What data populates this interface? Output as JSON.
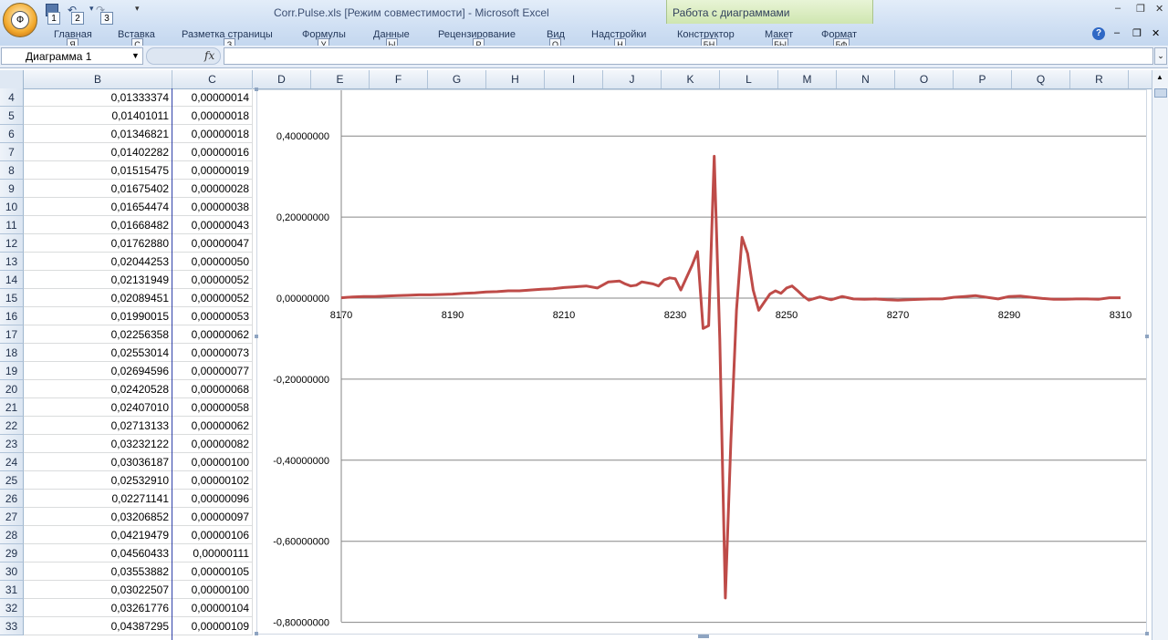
{
  "window": {
    "title": "Corr.Pulse.xls  [Режим совместимости] - Microsoft Excel",
    "context_group": "Работа с диаграммами",
    "office_button_keytip": "Ф",
    "qat_keytips": [
      "1",
      "2",
      "3"
    ],
    "controls": [
      "–",
      "❐",
      "✕"
    ],
    "ribbon_controls": [
      "–",
      "❐",
      "✕"
    ]
  },
  "ribbon": {
    "tabs": [
      {
        "label": "Главная",
        "keytip": "Я"
      },
      {
        "label": "Вставка",
        "keytip": "С"
      },
      {
        "label": "Разметка страницы",
        "keytip": "З"
      },
      {
        "label": "Формулы",
        "keytip": "У"
      },
      {
        "label": "Данные",
        "keytip": "Ы"
      },
      {
        "label": "Рецензирование",
        "keytip": "Р"
      },
      {
        "label": "Вид",
        "keytip": "О"
      },
      {
        "label": "Надстройки",
        "keytip": "Н"
      },
      {
        "label": "Конструктор",
        "keytip": "БН"
      },
      {
        "label": "Макет",
        "keytip": "БЫ"
      },
      {
        "label": "Формат",
        "keytip": "БФ"
      }
    ],
    "help": "?"
  },
  "formula_bar": {
    "name_box": "Диаграмма 1",
    "fx": "fx",
    "formula": ""
  },
  "sheet": {
    "columns": [
      "B",
      "C",
      "D",
      "E",
      "F",
      "G",
      "H",
      "I",
      "J",
      "K",
      "L",
      "M",
      "N",
      "O",
      "P",
      "Q",
      "R"
    ],
    "rows": [
      {
        "row": "4",
        "b": "0,01333374",
        "c": "0,00000014"
      },
      {
        "row": "5",
        "b": "0,01401011",
        "c": "0,00000018"
      },
      {
        "row": "6",
        "b": "0,01346821",
        "c": "0,00000018"
      },
      {
        "row": "7",
        "b": "0,01402282",
        "c": "0,00000016"
      },
      {
        "row": "8",
        "b": "0,01515475",
        "c": "0,00000019"
      },
      {
        "row": "9",
        "b": "0,01675402",
        "c": "0,00000028"
      },
      {
        "row": "10",
        "b": "0,01654474",
        "c": "0,00000038"
      },
      {
        "row": "11",
        "b": "0,01668482",
        "c": "0,00000043"
      },
      {
        "row": "12",
        "b": "0,01762880",
        "c": "0,00000047"
      },
      {
        "row": "13",
        "b": "0,02044253",
        "c": "0,00000050"
      },
      {
        "row": "14",
        "b": "0,02131949",
        "c": "0,00000052"
      },
      {
        "row": "15",
        "b": "0,02089451",
        "c": "0,00000052"
      },
      {
        "row": "16",
        "b": "0,01990015",
        "c": "0,00000053"
      },
      {
        "row": "17",
        "b": "0,02256358",
        "c": "0,00000062"
      },
      {
        "row": "18",
        "b": "0,02553014",
        "c": "0,00000073"
      },
      {
        "row": "19",
        "b": "0,02694596",
        "c": "0,00000077"
      },
      {
        "row": "20",
        "b": "0,02420528",
        "c": "0,00000068"
      },
      {
        "row": "21",
        "b": "0,02407010",
        "c": "0,00000058"
      },
      {
        "row": "22",
        "b": "0,02713133",
        "c": "0,00000062"
      },
      {
        "row": "23",
        "b": "0,03232122",
        "c": "0,00000082"
      },
      {
        "row": "24",
        "b": "0,03036187",
        "c": "0,00000100"
      },
      {
        "row": "25",
        "b": "0,02532910",
        "c": "0,00000102"
      },
      {
        "row": "26",
        "b": "0,02271141",
        "c": "0,00000096"
      },
      {
        "row": "27",
        "b": "0,03206852",
        "c": "0,00000097"
      },
      {
        "row": "28",
        "b": "0,04219479",
        "c": "0,00000106"
      },
      {
        "row": "29",
        "b": "0,04560433",
        "c": "0,00000111"
      },
      {
        "row": "30",
        "b": "0,03553882",
        "c": "0,00000105"
      },
      {
        "row": "31",
        "b": "0,03022507",
        "c": "0,00000100"
      },
      {
        "row": "32",
        "b": "0,03261776",
        "c": "0,00000104"
      },
      {
        "row": "33",
        "b": "0,04387295",
        "c": "0,00000109"
      }
    ]
  },
  "chart_data": {
    "type": "line",
    "title": "",
    "xlabel": "",
    "ylabel": "",
    "xlim": [
      8170,
      8310
    ],
    "ylim": [
      -0.8,
      0.5
    ],
    "x_ticks": [
      "8170",
      "8190",
      "8210",
      "8230",
      "8250",
      "8270",
      "8290",
      "8310"
    ],
    "y_ticks": [
      "0,40000000",
      "0,20000000",
      "0,00000000",
      "-0,20000000",
      "-0,40000000",
      "-0,60000000",
      "-0,80000000"
    ],
    "y_tick_values": [
      0.4,
      0.2,
      0.0,
      -0.2,
      -0.4,
      -0.6,
      -0.8
    ],
    "grid": true,
    "legend": "none",
    "color": "#be4b48",
    "series": [
      {
        "x": [
          8170,
          8172,
          8174,
          8176,
          8178,
          8180,
          8182,
          8184,
          8186,
          8188,
          8190,
          8192,
          8194,
          8196,
          8198,
          8200,
          8202,
          8204,
          8206,
          8208,
          8210,
          8212,
          8214,
          8216,
          8218,
          8220,
          8221,
          8222,
          8223,
          8224,
          8226,
          8227,
          8228,
          8229,
          8230,
          8231,
          8232,
          8233,
          8234,
          8235,
          8236,
          8237,
          8238,
          8239,
          8240,
          8241,
          8242,
          8243,
          8244,
          8245,
          8246,
          8247,
          8248,
          8249,
          8250,
          8251,
          8252,
          8253,
          8254,
          8256,
          8258,
          8260,
          8262,
          8264,
          8266,
          8268,
          8270,
          8272,
          8274,
          8276,
          8278,
          8280,
          8282,
          8284,
          8286,
          8288,
          8290,
          8292,
          8294,
          8296,
          8298,
          8300,
          8302,
          8304,
          8306,
          8308,
          8310
        ],
        "y": [
          0.001,
          0.003,
          0.004,
          0.004,
          0.005,
          0.006,
          0.007,
          0.008,
          0.008,
          0.009,
          0.01,
          0.012,
          0.013,
          0.015,
          0.016,
          0.018,
          0.018,
          0.02,
          0.022,
          0.023,
          0.026,
          0.028,
          0.03,
          0.025,
          0.04,
          0.042,
          0.035,
          0.03,
          0.032,
          0.04,
          0.035,
          0.03,
          0.045,
          0.05,
          0.048,
          0.02,
          0.05,
          0.08,
          0.115,
          -0.075,
          -0.068,
          0.35,
          -0.1,
          -0.74,
          -0.35,
          -0.03,
          0.15,
          0.11,
          0.02,
          -0.03,
          -0.01,
          0.01,
          0.018,
          0.012,
          0.025,
          0.03,
          0.018,
          0.005,
          -0.005,
          0.003,
          -0.004,
          0.004,
          -0.002,
          -0.003,
          -0.002,
          -0.004,
          -0.005,
          -0.004,
          -0.003,
          -0.002,
          -0.002,
          0.002,
          0.004,
          0.006,
          0.002,
          -0.002,
          0.004,
          0.005,
          0.002,
          -0.001,
          -0.003,
          -0.003,
          -0.002,
          -0.002,
          -0.003,
          0.001,
          0.001
        ]
      }
    ]
  }
}
